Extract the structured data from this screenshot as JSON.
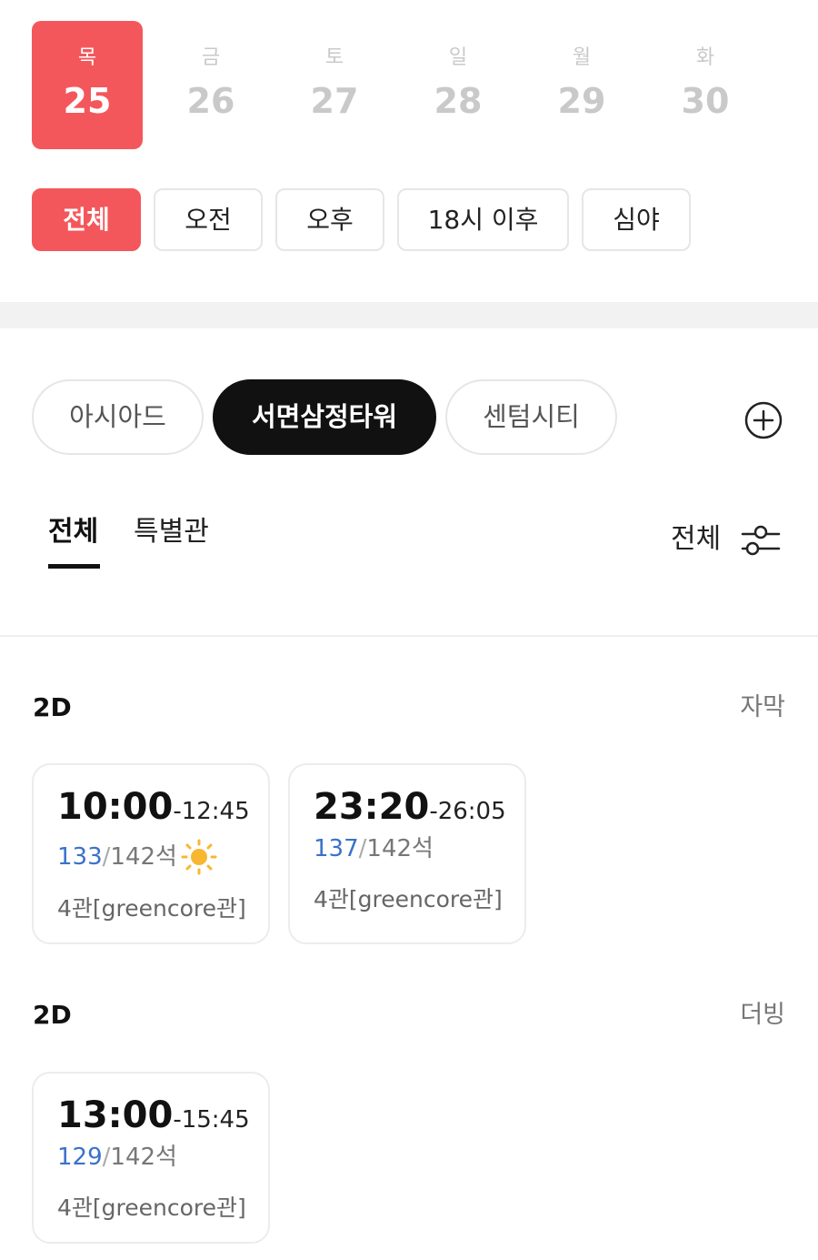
{
  "dates": [
    {
      "dow": "목",
      "day": "25",
      "selected": true
    },
    {
      "dow": "금",
      "day": "26",
      "selected": false
    },
    {
      "dow": "토",
      "day": "27",
      "selected": false
    },
    {
      "dow": "일",
      "day": "28",
      "selected": false
    },
    {
      "dow": "월",
      "day": "29",
      "selected": false
    },
    {
      "dow": "화",
      "day": "30",
      "selected": false
    }
  ],
  "time_filters": [
    {
      "label": "전체",
      "selected": true
    },
    {
      "label": "오전",
      "selected": false
    },
    {
      "label": "오후",
      "selected": false
    },
    {
      "label": "18시 이후",
      "selected": false
    },
    {
      "label": "심야",
      "selected": false
    }
  ],
  "theaters": [
    {
      "label": "아시아드",
      "selected": false
    },
    {
      "label": "서면삼정타워",
      "selected": true
    },
    {
      "label": "센텀시티",
      "selected": false
    }
  ],
  "add_theater_icon": "plus-circle-icon",
  "tabs": [
    {
      "label": "전체",
      "selected": true
    },
    {
      "label": "특별관",
      "selected": false
    }
  ],
  "filter": {
    "label": "전체",
    "icon": "sliders-icon"
  },
  "sections": [
    {
      "format": "2D",
      "language": "자막",
      "showtimes": [
        {
          "start": "10:00",
          "end": "-12:45",
          "seats_available": "133",
          "seats_total": "142석",
          "hall": "4관[greencore관]",
          "morning_icon": "sun-icon"
        },
        {
          "start": "23:20",
          "end": "-26:05",
          "seats_available": "137",
          "seats_total": "142석",
          "hall": "4관[greencore관]"
        }
      ]
    },
    {
      "format": "2D",
      "language": "더빙",
      "showtimes": [
        {
          "start": "13:00",
          "end": "-15:45",
          "seats_available": "129",
          "seats_total": "142석",
          "hall": "4관[greencore관]"
        }
      ]
    }
  ],
  "colors": {
    "accent": "#f4575b",
    "seat_available": "#3a72c9",
    "dark_pill": "#111111"
  }
}
